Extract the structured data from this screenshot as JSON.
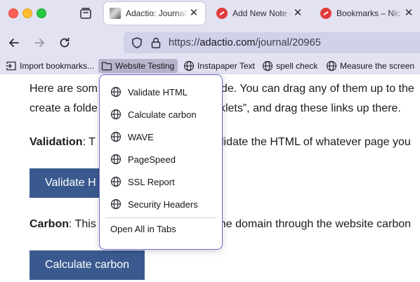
{
  "tabs": [
    {
      "title": "Adactio: Journal—",
      "active": true,
      "favicon": "photo-favicon"
    },
    {
      "title": "Add New Note ‹ N",
      "active": false,
      "favicon": "red-favicon"
    },
    {
      "title": "Bookmarks – Nic",
      "active": false,
      "favicon": "red-favicon"
    }
  ],
  "tab_close_glyph": "✕",
  "address": {
    "scheme": "https://",
    "host": "adactio.com",
    "path": "/journal/20965"
  },
  "bookmarks": [
    {
      "label": "Import bookmarks...",
      "icon": "import-icon"
    },
    {
      "label": "Website Testing",
      "icon": "folder-icon"
    },
    {
      "label": "Instapaper Text",
      "icon": "globe-icon"
    },
    {
      "label": "spell check",
      "icon": "globe-icon"
    },
    {
      "label": "Measure the screen",
      "icon": "globe-icon"
    }
  ],
  "menu": {
    "items": [
      "Validate HTML",
      "Calculate carbon",
      "WAVE",
      "PageSpeed",
      "SSL Report",
      "Security Headers"
    ],
    "open_all": "Open All in Tabs"
  },
  "page": {
    "para1_line1_start": "Here are som",
    "para1_line1_end": "de. You can drag any of them up to the",
    "para1_line2_start": "create a folde",
    "para1_line2_end": "klets”, and drag these links up there.",
    "validation_label": "Validation",
    "validation_start": ": T",
    "validation_end": "lidate the HTML of whatever page you",
    "validate_button": "Validate H",
    "carbon_label": "Carbon",
    "carbon_start": ": This",
    "carbon_end": "he domain through the website carbon",
    "carbon_button": "Calculate carbon"
  },
  "colors": {
    "chrome_bg": "#e3e2f2",
    "urlbar_bg": "#d2d1ea",
    "page_button": "#3a5a8f",
    "menu_border": "#6b6fd0"
  }
}
